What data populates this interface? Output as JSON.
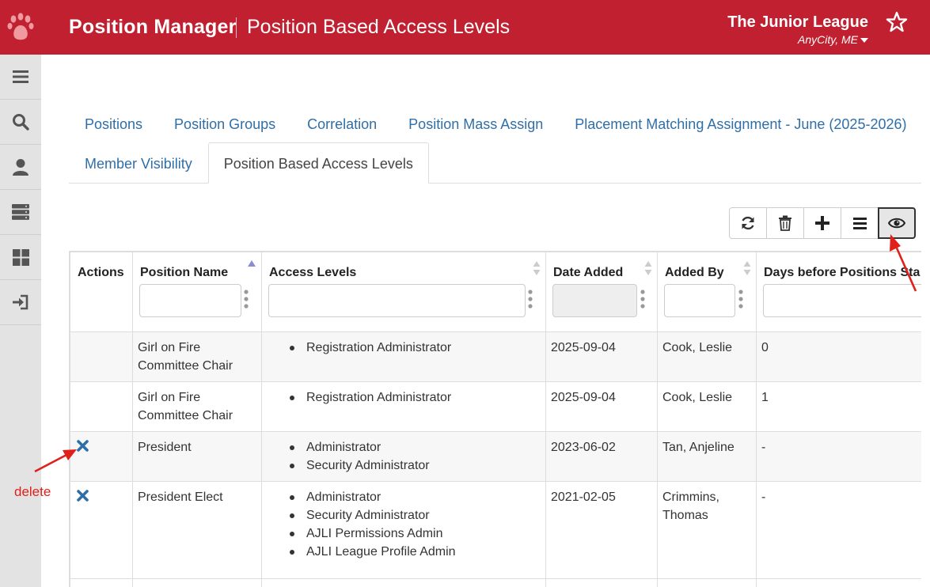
{
  "header": {
    "app_title": "Position Manager",
    "page_title": "Position Based Access Levels",
    "org_name": "The Junior League",
    "org_city": "AnyCity, ME",
    "logo_icon": "paw-icon",
    "favorite_icon": "star-icon"
  },
  "colors": {
    "brand": "#c0202f",
    "link": "#2f6fa7",
    "annotation": "#e0201a",
    "delete": "#2f6fa7"
  },
  "sidebar": {
    "items": [
      {
        "icon": "menu-icon"
      },
      {
        "icon": "search-icon"
      },
      {
        "icon": "user-icon"
      },
      {
        "icon": "server-icon"
      },
      {
        "icon": "grid-icon"
      },
      {
        "icon": "sign-in-icon"
      }
    ]
  },
  "tabs": {
    "row1": [
      "Positions",
      "Position Groups",
      "Correlation",
      "Position Mass Assign",
      "Placement Matching Assignment - June (2025-2026)"
    ],
    "row2": [
      "Member Visibility",
      "Position Based Access Levels"
    ],
    "active": "Position Based Access Levels"
  },
  "toolbar": {
    "buttons": [
      {
        "icon": "refresh-icon"
      },
      {
        "icon": "trash-icon"
      },
      {
        "icon": "plus-icon"
      },
      {
        "icon": "list-icon"
      },
      {
        "icon": "eye-icon",
        "active": true
      }
    ]
  },
  "table": {
    "columns": [
      "Actions",
      "Position Name",
      "Access Levels",
      "Date Added",
      "Added By",
      "Days before Positions Sta"
    ],
    "rows": [
      {
        "deletable": false,
        "position": "Girl on Fire Committee Chair",
        "access": [
          "Registration Administrator"
        ],
        "date": "2025-09-04",
        "added_by": "Cook, Leslie",
        "days": "0"
      },
      {
        "deletable": false,
        "position": "Girl on Fire Committee Chair",
        "access": [
          "Registration Administrator"
        ],
        "date": "2025-09-04",
        "added_by": "Cook, Leslie",
        "days": "1"
      },
      {
        "deletable": true,
        "position": "President",
        "access": [
          "Administrator",
          "Security Administrator"
        ],
        "date": "2023-06-02",
        "added_by": "Tan, Anjeline",
        "days": "-"
      },
      {
        "deletable": true,
        "position": "President Elect",
        "access": [
          "Administrator",
          "Security Administrator",
          "AJLI Permissions Admin",
          "AJLI League Profile Admin"
        ],
        "date": "2021-02-05",
        "added_by": "Crimmins, Thomas",
        "days": "-"
      }
    ]
  },
  "annotations": {
    "delete_label": "delete"
  }
}
